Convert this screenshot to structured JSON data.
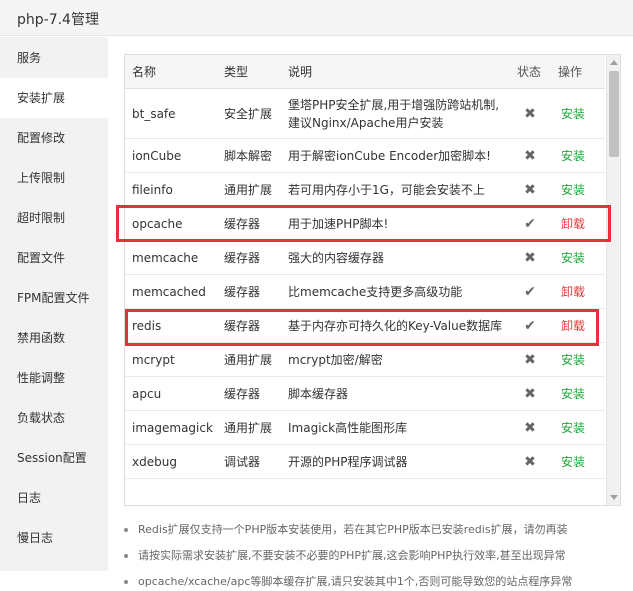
{
  "window": {
    "title": "php-7.4管理"
  },
  "sidebar": {
    "items": [
      {
        "label": "服务"
      },
      {
        "label": "安装扩展"
      },
      {
        "label": "配置修改"
      },
      {
        "label": "上传限制"
      },
      {
        "label": "超时限制"
      },
      {
        "label": "配置文件"
      },
      {
        "label": "FPM配置文件"
      },
      {
        "label": "禁用函数"
      },
      {
        "label": "性能调整"
      },
      {
        "label": "负载状态"
      },
      {
        "label": "Session配置"
      },
      {
        "label": "日志"
      },
      {
        "label": "慢日志"
      }
    ],
    "active_index": 1
  },
  "table": {
    "headers": {
      "name": "名称",
      "type": "类型",
      "desc": "说明",
      "status": "状态",
      "op": "操作"
    },
    "rows": [
      {
        "name": "bt_safe",
        "type": "安全扩展",
        "desc_line1": "堡塔PHP安全扩展,用于增强防跨站机制,",
        "desc_line2": "建议Nginx/Apache用户安装",
        "status": "✖",
        "op": "安装"
      },
      {
        "name": "ionCube",
        "type": "脚本解密",
        "desc": "用于解密ionCube Encoder加密脚本!",
        "status": "✖",
        "op": "安装"
      },
      {
        "name": "fileinfo",
        "type": "通用扩展",
        "desc": "若可用内存小于1G，可能会安装不上",
        "status": "✖",
        "op": "安装"
      },
      {
        "name": "opcache",
        "type": "缓存器",
        "desc": "用于加速PHP脚本!",
        "status": "✔",
        "op": "卸载"
      },
      {
        "name": "memcache",
        "type": "缓存器",
        "desc": "强大的内容缓存器",
        "status": "✖",
        "op": "安装"
      },
      {
        "name": "memcached",
        "type": "缓存器",
        "desc": "比memcache支持更多高级功能",
        "status": "✔",
        "op": "卸载"
      },
      {
        "name": "redis",
        "type": "缓存器",
        "desc": "基于内存亦可持久化的Key-Value数据库",
        "status": "✔",
        "op": "卸载"
      },
      {
        "name": "mcrypt",
        "type": "通用扩展",
        "desc": "mcrypt加密/解密",
        "status": "✖",
        "op": "安装"
      },
      {
        "name": "apcu",
        "type": "缓存器",
        "desc": "脚本缓存器",
        "status": "✖",
        "op": "安装"
      },
      {
        "name": "imagemagick",
        "type": "通用扩展",
        "desc": "Imagick高性能图形库",
        "status": "✖",
        "op": "安装"
      },
      {
        "name": "xdebug",
        "type": "调试器",
        "desc": "开源的PHP程序调试器",
        "status": "✖",
        "op": "安装"
      }
    ]
  },
  "notes": [
    "Redis扩展仅支持一个PHP版本安装使用，若在其它PHP版本已安装redis扩展，请勿再装",
    "请按实际需求安装扩展,不要安装不必要的PHP扩展,这会影响PHP执行效率,甚至出现异常",
    "opcache/xcache/apc等脚本缓存扩展,请只安装其中1个,否则可能导致您的站点程序异常"
  ],
  "colors": {
    "install": "#20a53a",
    "uninstall": "#e33a3a",
    "highlight": "#e8303a",
    "sidebar_bg": "#f2f2f2"
  }
}
